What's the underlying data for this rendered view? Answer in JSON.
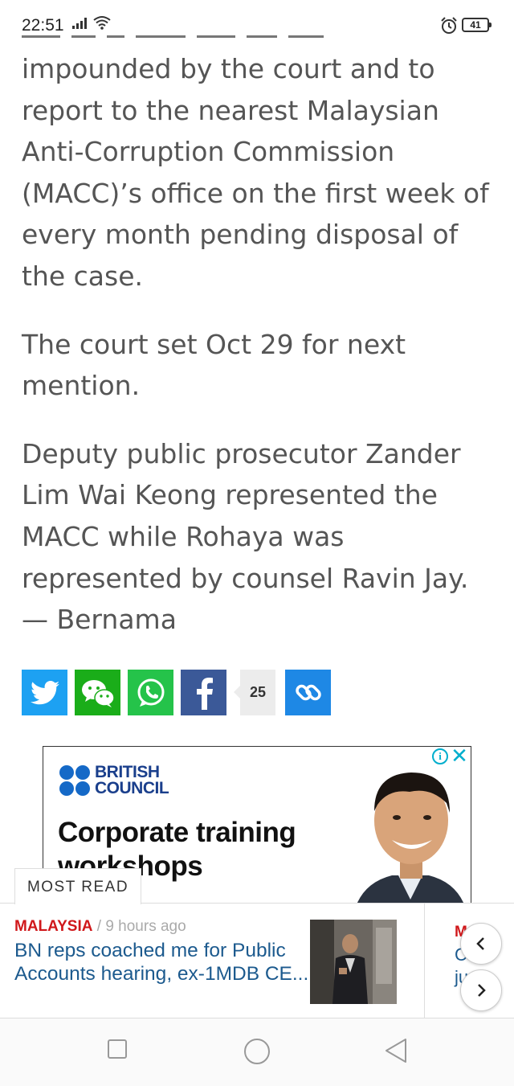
{
  "status_bar": {
    "time": "22:51",
    "battery": "41"
  },
  "article": {
    "paragraphs": [
      "impounded by the court and to report to the nearest Malaysian Anti-Corruption Commission (MACC)’s office on the first week of every month pending disposal of the case.",
      "The court set Oct 29 for next mention.",
      "Deputy public prosecutor Zander Lim Wai Keong represented the MACC while Rohaya was represented by counsel Ravin Jay. — Bernama"
    ]
  },
  "share": {
    "count": "25",
    "colors": {
      "twitter": "#1da1f2",
      "wechat": "#1aad19",
      "whatsapp": "#25c34a",
      "facebook": "#3b5998",
      "link": "#1e88e5"
    }
  },
  "ad": {
    "brand_line1": "BRITISH",
    "brand_line2": "COUNCIL",
    "headline": "Corporate training workshops",
    "info_icon": "info-icon",
    "close_icon": "close-icon"
  },
  "most_read": {
    "tab_label": "MOST READ",
    "items": [
      {
        "category": "MALAYSIA",
        "separator": " / ",
        "time": "9 hours ago",
        "title": "BN reps coached me for Public Accounts hearing, ex-1MDB CE..."
      },
      {
        "category": "M",
        "title_line1": "C",
        "title_line2": "ju"
      }
    ]
  },
  "nav": {
    "icons": [
      "square-icon",
      "circle-icon",
      "triangle-back-icon"
    ]
  }
}
